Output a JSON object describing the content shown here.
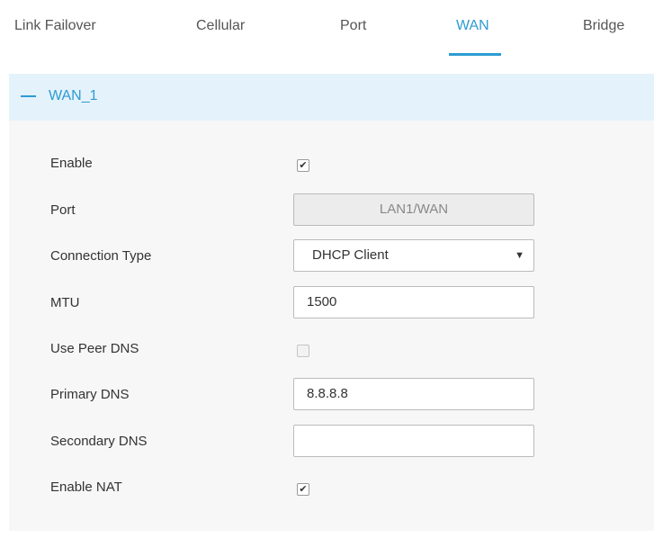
{
  "tabs": [
    {
      "label": "Link Failover",
      "active": false
    },
    {
      "label": "Cellular",
      "active": false
    },
    {
      "label": "Port",
      "active": false
    },
    {
      "label": "WAN",
      "active": true
    },
    {
      "label": "Bridge",
      "active": false
    }
  ],
  "accent_color": "#2d9bd2",
  "section": {
    "title": "WAN_1",
    "collapse_icon": "minus-icon"
  },
  "form": {
    "enable": {
      "label": "Enable",
      "checked": true
    },
    "port": {
      "label": "Port",
      "value": "LAN1/WAN",
      "disabled": true
    },
    "connection_type": {
      "label": "Connection Type",
      "value": "DHCP Client"
    },
    "mtu": {
      "label": "MTU",
      "value": "1500"
    },
    "use_peer_dns": {
      "label": "Use Peer DNS",
      "checked": false
    },
    "primary_dns": {
      "label": "Primary DNS",
      "value": "8.8.8.8"
    },
    "secondary_dns": {
      "label": "Secondary DNS",
      "value": ""
    },
    "enable_nat": {
      "label": "Enable NAT",
      "checked": true
    }
  },
  "check_mark": "✔",
  "dropdown_arrow": "▼"
}
